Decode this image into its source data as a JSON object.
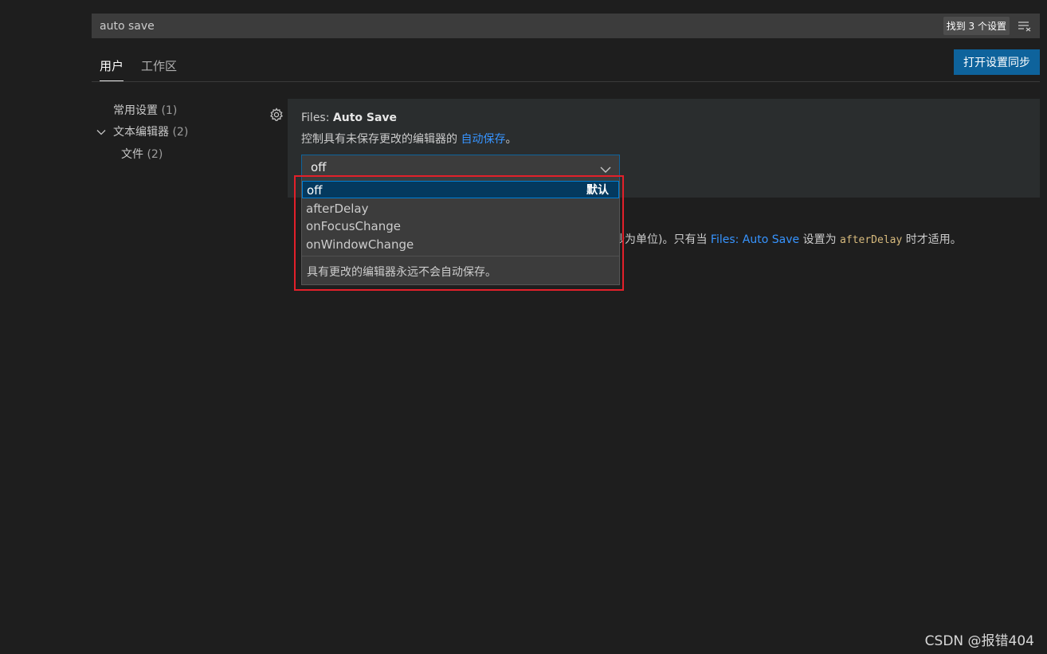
{
  "search": {
    "value": "auto save",
    "result_count": "找到 3 个设置"
  },
  "tabs": [
    {
      "label": "用户",
      "active": true
    },
    {
      "label": "工作区",
      "active": false
    }
  ],
  "sync_button": "打开设置同步",
  "toc": [
    {
      "label": "常用设置",
      "count": "(1)"
    },
    {
      "label": "文本编辑器",
      "count": "(2)",
      "expanded": true
    },
    {
      "label": "文件",
      "count": "(2)"
    }
  ],
  "setting": {
    "category": "Files: ",
    "name": "Auto Save",
    "desc_prefix": "控制具有未保存更改的编辑器的 ",
    "desc_link": "自动保存",
    "desc_suffix": "。",
    "value": "off"
  },
  "dropdown": {
    "options": [
      {
        "label": "off",
        "default_label": "默认",
        "selected": true
      },
      {
        "label": "afterDelay"
      },
      {
        "label": "onFocusChange"
      },
      {
        "label": "onWindowChange"
      }
    ],
    "description": "具有更改的编辑器永远不会自动保存。"
  },
  "partial_setting_desc": {
    "prefix": "秒为单位)。只有当 ",
    "link": "Files: Auto Save",
    "middle": " 设置为 ",
    "code": "afterDelay",
    "suffix": " 时才适用。"
  },
  "watermark": "CSDN @报错404",
  "colors": {
    "accent": "#0e639c",
    "link": "#3794ff",
    "highlight": "#e3202a"
  }
}
